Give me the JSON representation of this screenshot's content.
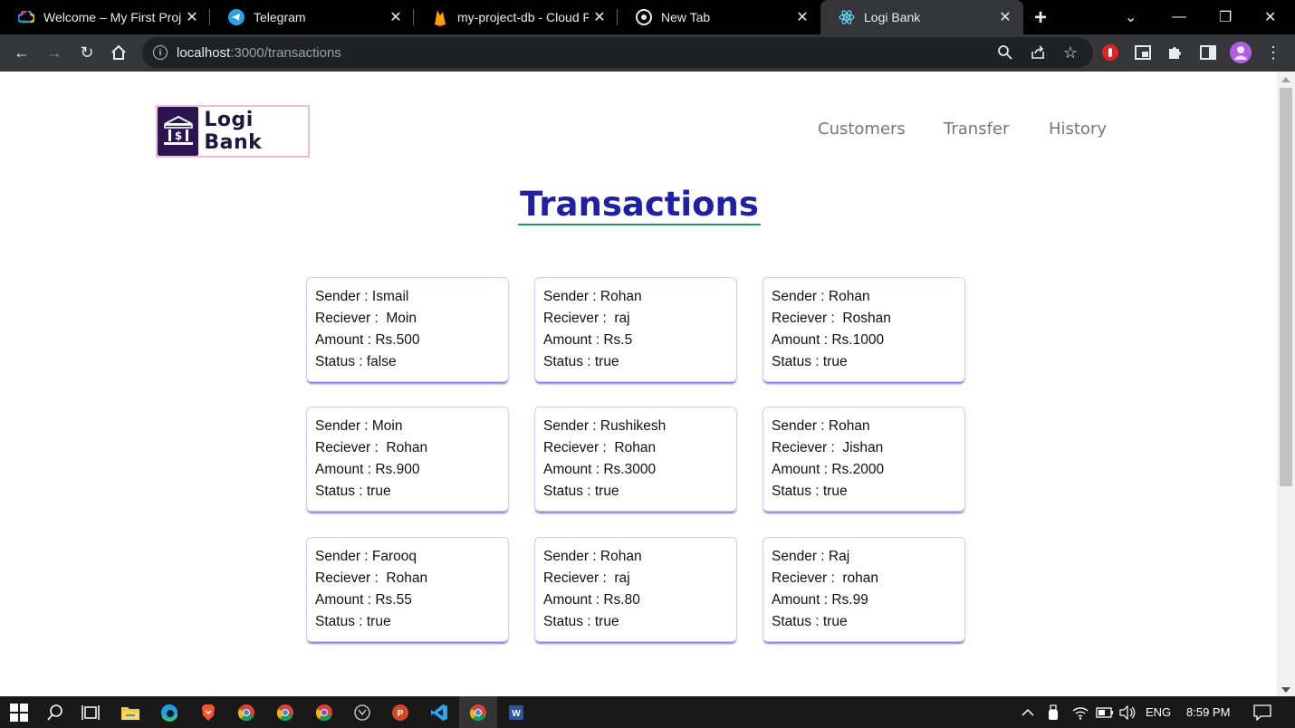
{
  "browser": {
    "tabs": [
      {
        "title": "Welcome – My First Proje",
        "icon": "google-cloud-icon"
      },
      {
        "title": "Telegram",
        "icon": "telegram-icon"
      },
      {
        "title": "my-project-db - Cloud Fir",
        "icon": "firebase-icon"
      },
      {
        "title": "New Tab",
        "icon": "chrome-icon"
      },
      {
        "title": "Logi Bank",
        "icon": "react-icon"
      }
    ],
    "address": {
      "host": "localhost",
      "path": ":3000/transactions"
    }
  },
  "page": {
    "logo_text": "Logi Bank",
    "nav": [
      "Customers",
      "Transfer",
      "History"
    ],
    "heading": "Transactions",
    "transactions": [
      {
        "sender": "Sender : Ismail",
        "receiver": "Reciever :  Moin",
        "amount": "Amount : Rs.500",
        "status": "Status : false"
      },
      {
        "sender": "Sender : Rohan",
        "receiver": "Reciever :  raj",
        "amount": "Amount : Rs.5",
        "status": "Status : true"
      },
      {
        "sender": "Sender : Rohan",
        "receiver": "Reciever :  Roshan",
        "amount": "Amount : Rs.1000",
        "status": "Status : true"
      },
      {
        "sender": "Sender : Moin",
        "receiver": "Reciever :  Rohan",
        "amount": "Amount : Rs.900",
        "status": "Status : true"
      },
      {
        "sender": "Sender : Rushikesh",
        "receiver": "Reciever :  Rohan",
        "amount": "Amount : Rs.3000",
        "status": "Status : true"
      },
      {
        "sender": "Sender : Rohan",
        "receiver": "Reciever :  Jishan",
        "amount": "Amount : Rs.2000",
        "status": "Status : true"
      },
      {
        "sender": "Sender : Farooq",
        "receiver": "Reciever :  Rohan",
        "amount": "Amount : Rs.55",
        "status": "Status : true"
      },
      {
        "sender": "Sender : Rohan",
        "receiver": "Reciever :  raj",
        "amount": "Amount : Rs.80",
        "status": "Status : true"
      },
      {
        "sender": "Sender : Raj",
        "receiver": "Reciever :  rohan",
        "amount": "Amount : Rs.99",
        "status": "Status : true"
      }
    ]
  },
  "taskbar": {
    "language": "ENG",
    "time": "8:59 PM"
  },
  "colors": {
    "heading": "#2020a6",
    "heading_underline": "#2c9a66",
    "card_shadow": "#8f6fd6",
    "logo_border": "#f5bcd0"
  }
}
